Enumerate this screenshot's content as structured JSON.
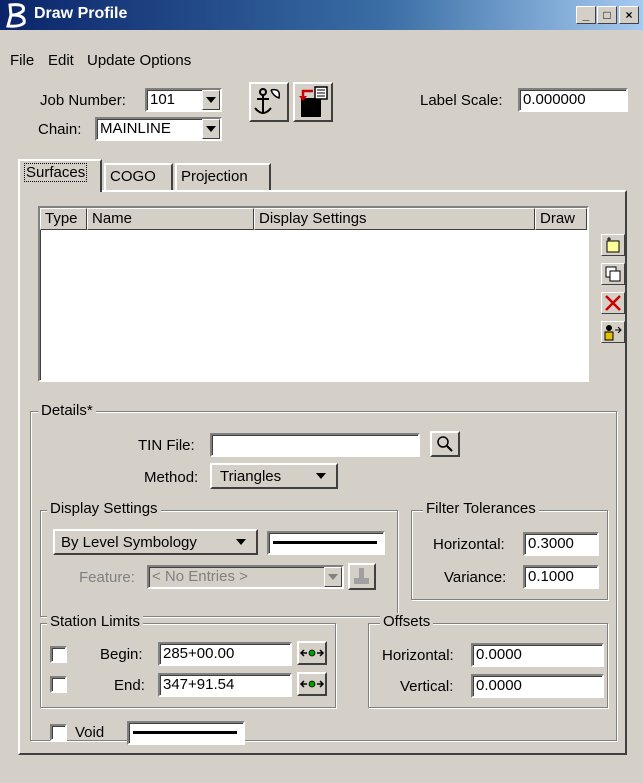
{
  "window": {
    "title": "Draw Profile",
    "min_label": "_",
    "max_label": "□",
    "close_label": "×"
  },
  "menu": {
    "file": "File",
    "edit": "Edit",
    "update_options": "Update Options"
  },
  "job": {
    "label": "Job Number:",
    "value": "101"
  },
  "chain": {
    "label": "Chain:",
    "value": "MAINLINE"
  },
  "label_scale": {
    "label": "Label Scale:",
    "value": "0.000000"
  },
  "tabs": [
    {
      "label": "Surfaces"
    },
    {
      "label": "COGO"
    },
    {
      "label": "Projection"
    }
  ],
  "list": {
    "columns": [
      {
        "label": "Type"
      },
      {
        "label": "Name"
      },
      {
        "label": "Display Settings"
      },
      {
        "label": "Draw"
      }
    ],
    "rows": []
  },
  "details": {
    "title": "Details*",
    "tin_file": {
      "label": "TIN File:",
      "value": ""
    },
    "method": {
      "label": "Method:",
      "value": "Triangles"
    }
  },
  "display_settings": {
    "title": "Display Settings",
    "symbology": "By Level Symbology",
    "feature_label": "Feature:",
    "feature_value": "< No Entries >"
  },
  "filter_tolerances": {
    "title": "Filter Tolerances",
    "horizontal_label": "Horizontal:",
    "horizontal_value": "0.3000",
    "variance_label": "Variance:",
    "variance_value": "0.1000"
  },
  "station_limits": {
    "title": "Station Limits",
    "begin_label": "Begin:",
    "begin_value": "285+00.00",
    "begin_checked": false,
    "end_label": "End:",
    "end_value": "347+91.54",
    "end_checked": false
  },
  "offsets": {
    "title": "Offsets",
    "horizontal_label": "Horizontal:",
    "horizontal_value": "0.0000",
    "vertical_label": "Vertical:",
    "vertical_value": "0.0000"
  },
  "void": {
    "label": "Void",
    "checked": false
  },
  "colors": {
    "title_start": "#0a246a",
    "title_end": "#a6caf0",
    "face": "#d4d0c8",
    "delete_red": "#cc0000"
  }
}
